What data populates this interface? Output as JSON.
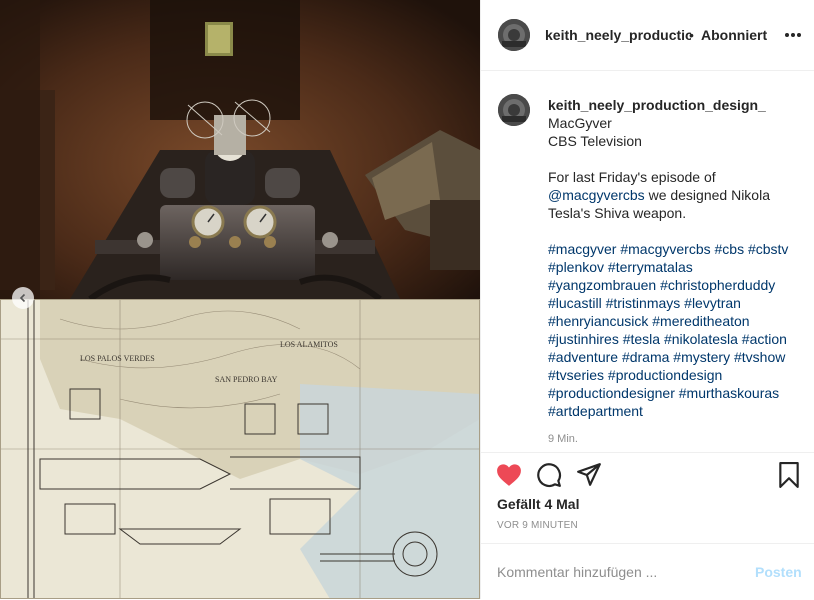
{
  "post": {
    "username": "keith_neely_production_design_",
    "header_username": "keith_neely_productior",
    "separator": "•",
    "follow_status": "Abonniert",
    "caption_lines": [
      "MacGyver",
      "CBS Television"
    ],
    "caption_body_parts": [
      "For last Friday's episode of ",
      "@macgyvercbs",
      " we designed Nikola Tesla's Shiva weapon."
    ],
    "hashtags": "#macgyver #macgyvercbs #cbs #cbstv #plenkov #terrymatalas #yangzombrauen #christopherduddy #lucastill #tristinmays #levytran #henryiancusick #mereditheaton #justinhires #tesla #nikolatesla #action #adventure #drama #mystery #tvshow #tvseries #productiondesign #productiondesigner #murthaskouras #artdepartment",
    "time_short": "9 Min.",
    "likes_text": "Gefällt 4 Mal",
    "time_ago": "VOR 9 MINUTEN"
  },
  "comment": {
    "placeholder": "Kommentar hinzufügen ...",
    "post_label": "Posten"
  },
  "colors": {
    "heart": "#ed4956",
    "link": "#00376b",
    "post_button_disabled": "#b2dffc",
    "muted": "#8e8e8e"
  },
  "icons": {
    "like": "heart-icon",
    "comment": "comment-icon",
    "share": "paper-plane-icon",
    "save": "bookmark-icon",
    "more": "more-options-icon",
    "carousel": "chevron-left-icon"
  }
}
